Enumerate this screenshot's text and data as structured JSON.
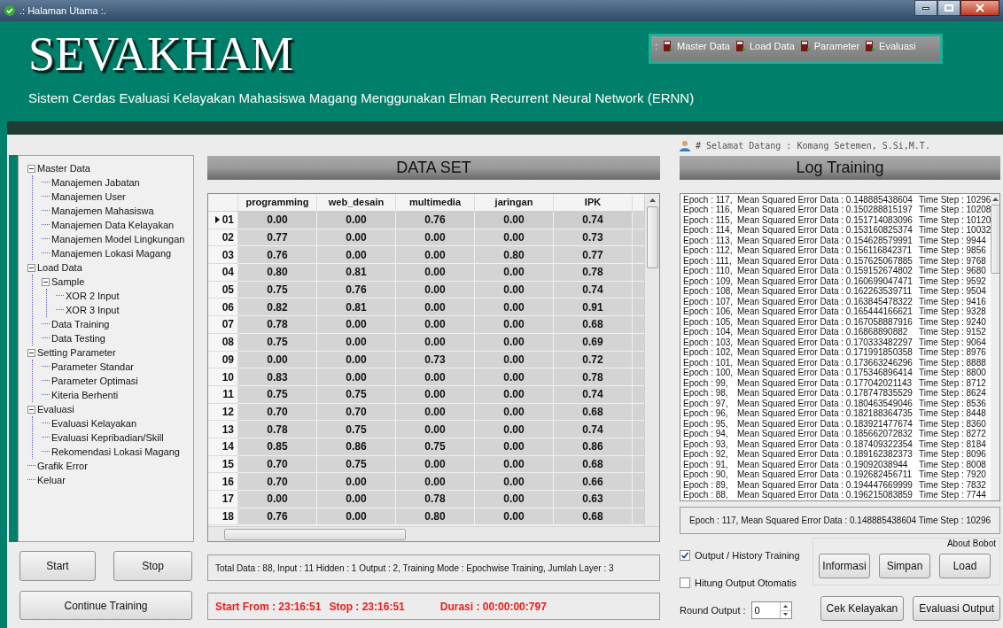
{
  "window": {
    "title": ".: Halaman Utama :."
  },
  "header": {
    "logo": "SEVAKHAM",
    "subtitle": "Sistem Cerdas Evaluasi Kelayakan Mahasiswa Magang Menggunakan Elman Recurrent Neural Network (ERNN)",
    "grip": ":",
    "menu": [
      {
        "label": "Master Data"
      },
      {
        "label": "Load Data"
      },
      {
        "label": "Parameter"
      },
      {
        "label": "Evaluasi"
      }
    ]
  },
  "sidebar": {
    "items": [
      {
        "label": "Master Data",
        "expanded": true,
        "children": [
          {
            "label": "Manajemen Jabatan"
          },
          {
            "label": "Manajemen User"
          },
          {
            "label": "Manajemen Mahasiswa"
          },
          {
            "label": "Manajemen Data Kelayakan"
          },
          {
            "label": "Manajemen Model Lingkungan"
          },
          {
            "label": "Manajemen Lokasi Magang"
          }
        ]
      },
      {
        "label": "Load Data",
        "expanded": true,
        "children": [
          {
            "label": "Sample",
            "expanded": true,
            "children": [
              {
                "label": "XOR 2 Input"
              },
              {
                "label": "XOR 3 Input"
              }
            ]
          },
          {
            "label": "Data Training"
          },
          {
            "label": "Data Testing"
          }
        ]
      },
      {
        "label": "Setting Parameter",
        "expanded": true,
        "children": [
          {
            "label": "Parameter Standar"
          },
          {
            "label": "Parameter Optimasi"
          },
          {
            "label": "Kiteria Berhenti"
          }
        ]
      },
      {
        "label": "Evaluasi",
        "expanded": true,
        "children": [
          {
            "label": "Evaluasi Kelayakan"
          },
          {
            "label": "Evaluasi Kepribadian/Skill"
          },
          {
            "label": "Rekomendasi Lokasi Magang"
          }
        ]
      },
      {
        "label": "Grafik Error"
      },
      {
        "label": "Keluar"
      }
    ]
  },
  "buttons": {
    "start": "Start",
    "stop": "Stop",
    "continue": "Continue Training"
  },
  "dataset": {
    "title": "DATA SET",
    "columns": [
      "programming",
      "web_desain",
      "multimedia",
      "jaringan",
      "IPK"
    ],
    "rows": [
      {
        "label": "01",
        "selected": true,
        "cells": [
          "0.00",
          "0.00",
          "0.76",
          "0.00",
          "0.74"
        ]
      },
      {
        "label": "02",
        "selected": false,
        "cells": [
          "0.77",
          "0.00",
          "0.00",
          "0.00",
          "0.73"
        ]
      },
      {
        "label": "03",
        "selected": false,
        "cells": [
          "0.76",
          "0.00",
          "0.00",
          "0.80",
          "0.77"
        ]
      },
      {
        "label": "04",
        "selected": false,
        "cells": [
          "0.80",
          "0.81",
          "0.00",
          "0.00",
          "0.78"
        ]
      },
      {
        "label": "05",
        "selected": false,
        "cells": [
          "0.75",
          "0.76",
          "0.00",
          "0.00",
          "0.74"
        ]
      },
      {
        "label": "06",
        "selected": false,
        "cells": [
          "0.82",
          "0.81",
          "0.00",
          "0.00",
          "0.91"
        ]
      },
      {
        "label": "07",
        "selected": false,
        "cells": [
          "0.78",
          "0.00",
          "0.00",
          "0.00",
          "0.68"
        ]
      },
      {
        "label": "08",
        "selected": false,
        "cells": [
          "0.75",
          "0.00",
          "0.00",
          "0.00",
          "0.69"
        ]
      },
      {
        "label": "09",
        "selected": false,
        "cells": [
          "0.00",
          "0.00",
          "0.73",
          "0.00",
          "0.72"
        ]
      },
      {
        "label": "10",
        "selected": false,
        "cells": [
          "0.83",
          "0.00",
          "0.00",
          "0.00",
          "0.78"
        ]
      },
      {
        "label": "11",
        "selected": false,
        "cells": [
          "0.75",
          "0.75",
          "0.00",
          "0.00",
          "0.74"
        ]
      },
      {
        "label": "12",
        "selected": false,
        "cells": [
          "0.70",
          "0.70",
          "0.00",
          "0.00",
          "0.68"
        ]
      },
      {
        "label": "13",
        "selected": false,
        "cells": [
          "0.78",
          "0.75",
          "0.00",
          "0.00",
          "0.74"
        ]
      },
      {
        "label": "14",
        "selected": false,
        "cells": [
          "0.85",
          "0.86",
          "0.75",
          "0.00",
          "0.86"
        ]
      },
      {
        "label": "15",
        "selected": false,
        "cells": [
          "0.70",
          "0.75",
          "0.00",
          "0.00",
          "0.68"
        ]
      },
      {
        "label": "16",
        "selected": false,
        "cells": [
          "0.70",
          "0.00",
          "0.00",
          "0.00",
          "0.66"
        ]
      },
      {
        "label": "17",
        "selected": false,
        "cells": [
          "0.00",
          "0.00",
          "0.78",
          "0.00",
          "0.63"
        ]
      },
      {
        "label": "18",
        "selected": false,
        "cells": [
          "0.76",
          "0.00",
          "0.80",
          "0.00",
          "0.68"
        ]
      }
    ],
    "info": "Total Data : 88,  Input : 11  Hidden : 1  Output : 2,  Training Mode : Epochwise Training,  Jumlah Layer : 3",
    "start_from": "Start From : 23:16:51",
    "stop": "Stop : 23:16:51",
    "durasi": "Durasi : 00:00:00:797"
  },
  "welcome": "# Selamat Datang : Komang Setemen, S.Si,M.T.",
  "log": {
    "title": "Log Training",
    "rows": [
      {
        "epoch": "Epoch :  117,",
        "mse": "Mean Squared Error Data :  0.148885438604",
        "step": "Time Step :  10296"
      },
      {
        "epoch": "Epoch :  116,",
        "mse": "Mean Squared Error Data :  0.150288815197",
        "step": "Time Step :  10208"
      },
      {
        "epoch": "Epoch :  115,",
        "mse": "Mean Squared Error Data :  0.151714083096",
        "step": "Time Step :  10120"
      },
      {
        "epoch": "Epoch :  114,",
        "mse": "Mean Squared Error Data :  0.153160825374",
        "step": "Time Step :  10032"
      },
      {
        "epoch": "Epoch :  113,",
        "mse": "Mean Squared Error Data :  0.154628579991",
        "step": "Time Step :  9944"
      },
      {
        "epoch": "Epoch :  112,",
        "mse": "Mean Squared Error Data :  0.156116842371",
        "step": "Time Step :  9856"
      },
      {
        "epoch": "Epoch :  111,",
        "mse": "Mean Squared Error Data :  0.157625067885",
        "step": "Time Step :  9768"
      },
      {
        "epoch": "Epoch :  110,",
        "mse": "Mean Squared Error Data :  0.159152674802",
        "step": "Time Step :  9680"
      },
      {
        "epoch": "Epoch :  109,",
        "mse": "Mean Squared Error Data :  0.160699047471",
        "step": "Time Step :  9592"
      },
      {
        "epoch": "Epoch :  108,",
        "mse": "Mean Squared Error Data :  0.162263539711",
        "step": "Time Step :  9504"
      },
      {
        "epoch": "Epoch :  107,",
        "mse": "Mean Squared Error Data :  0.163845478322",
        "step": "Time Step :  9416"
      },
      {
        "epoch": "Epoch :  106,",
        "mse": "Mean Squared Error Data :  0.165444166621",
        "step": "Time Step :  9328"
      },
      {
        "epoch": "Epoch :  105,",
        "mse": "Mean Squared Error Data :  0.167058887916",
        "step": "Time Step :  9240"
      },
      {
        "epoch": "Epoch :  104,",
        "mse": "Mean Squared Error Data :  0.16868890882",
        "step": "Time Step :  9152"
      },
      {
        "epoch": "Epoch :  103,",
        "mse": "Mean Squared Error Data :  0.170333482297",
        "step": "Time Step :  9064"
      },
      {
        "epoch": "Epoch :  102,",
        "mse": "Mean Squared Error Data :  0.171991850358",
        "step": "Time Step :  8976"
      },
      {
        "epoch": "Epoch :  101,",
        "mse": "Mean Squared Error Data :  0.173663246296",
        "step": "Time Step :  8888"
      },
      {
        "epoch": "Epoch :  100,",
        "mse": "Mean Squared Error Data :  0.175346896414",
        "step": "Time Step :  8800"
      },
      {
        "epoch": "Epoch :  99,",
        "mse": "Mean Squared Error Data :  0.177042021143",
        "step": "Time Step :  8712"
      },
      {
        "epoch": "Epoch :  98,",
        "mse": "Mean Squared Error Data :  0.178747835529",
        "step": "Time Step :  8624"
      },
      {
        "epoch": "Epoch :  97,",
        "mse": "Mean Squared Error Data :  0.180463549046",
        "step": "Time Step :  8536"
      },
      {
        "epoch": "Epoch :  96,",
        "mse": "Mean Squared Error Data :  0.182188364735",
        "step": "Time Step :  8448"
      },
      {
        "epoch": "Epoch :  95,",
        "mse": "Mean Squared Error Data :  0.183921477674",
        "step": "Time Step :  8360"
      },
      {
        "epoch": "Epoch :  94,",
        "mse": "Mean Squared Error Data :  0.185662072832",
        "step": "Time Step :  8272"
      },
      {
        "epoch": "Epoch :  93,",
        "mse": "Mean Squared Error Data :  0.187409322354",
        "step": "Time Step :  8184"
      },
      {
        "epoch": "Epoch :  92,",
        "mse": "Mean Squared Error Data :  0.189162382373",
        "step": "Time Step :  8096"
      },
      {
        "epoch": "Epoch :  91,",
        "mse": "Mean Squared Error Data :  0.19092038944",
        "step": "Time Step :  8008"
      },
      {
        "epoch": "Epoch :  90,",
        "mse": "Mean Squared Error Data :  0.192682456711",
        "step": "Time Step :  7920"
      },
      {
        "epoch": "Epoch :  89,",
        "mse": "Mean Squared Error Data :  0.194447669999",
        "step": "Time Step :  7832"
      },
      {
        "epoch": "Epoch :  88,",
        "mse": "Mean Squared Error Data :  0.196215083859",
        "step": "Time Step :  7744"
      }
    ],
    "summary": "Epoch :  117,  Mean Squared Error Data :  0.148885438604   Time Step :  10296"
  },
  "options": {
    "checkboxes": [
      {
        "label": "Output / History Training",
        "checked": true
      },
      {
        "label": "Hitung Output Otomatis",
        "checked": false
      }
    ],
    "round_output_label": "Round Output :",
    "round_output_value": "0",
    "about_bobot": {
      "title": "About Bobot",
      "buttons": [
        "Informasi",
        "Simpan",
        "Load"
      ]
    },
    "actions": [
      "Cek Kelayakan",
      "Evaluasi Output"
    ]
  }
}
